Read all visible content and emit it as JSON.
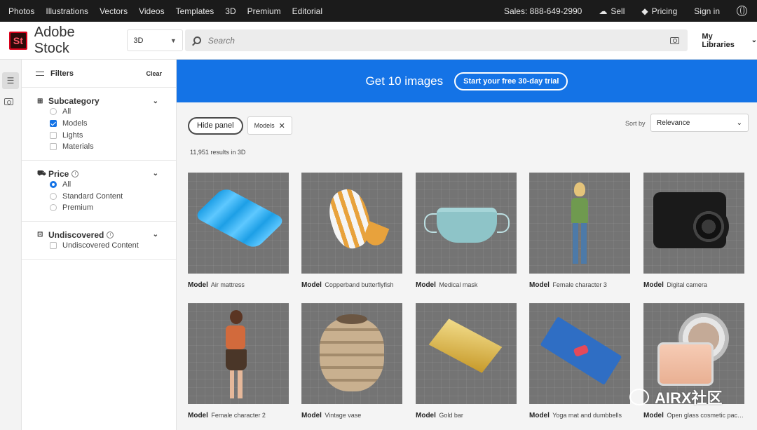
{
  "topnav": {
    "links": [
      "Photos",
      "Illustrations",
      "Vectors",
      "Videos",
      "Templates",
      "3D",
      "Premium",
      "Editorial"
    ],
    "sales": "Sales: 888-649-2990",
    "sell": "Sell",
    "pricing": "Pricing",
    "signin": "Sign in"
  },
  "header": {
    "logo_text": "St",
    "brand": "Adobe Stock",
    "category": "3D",
    "search_placeholder": "Search",
    "my_libraries": "My Libraries"
  },
  "filters": {
    "title": "Filters",
    "clear": "Clear",
    "subcategory": {
      "title": "Subcategory",
      "options": [
        {
          "label": "All",
          "checked": false
        },
        {
          "label": "Models",
          "checked": true
        },
        {
          "label": "Lights",
          "checked": false
        },
        {
          "label": "Materials",
          "checked": false
        }
      ]
    },
    "price": {
      "title": "Price",
      "options": [
        {
          "label": "All",
          "checked": true
        },
        {
          "label": "Standard Content",
          "checked": false
        },
        {
          "label": "Premium",
          "checked": false
        }
      ]
    },
    "undiscovered": {
      "title": "Undiscovered",
      "options": [
        {
          "label": "Undiscovered Content",
          "checked": false
        }
      ]
    }
  },
  "banner": {
    "text": "Get 10 images",
    "cta": "Start your free 30-day trial"
  },
  "toolbar": {
    "hide_panel": "Hide panel",
    "tag": "Models",
    "sort_label": "Sort by",
    "sort_value": "Relevance",
    "results": "11,951 results in 3D"
  },
  "items": [
    {
      "type": "Model",
      "title": "Air mattress",
      "art": "mattress"
    },
    {
      "type": "Model",
      "title": "Copperband butterflyfish",
      "art": "fish"
    },
    {
      "type": "Model",
      "title": "Medical mask",
      "art": "mask"
    },
    {
      "type": "Model",
      "title": "Female character 3",
      "art": "girl"
    },
    {
      "type": "Model",
      "title": "Digital camera",
      "art": "camera"
    },
    {
      "type": "Model",
      "title": "Female character 2",
      "art": "girl2"
    },
    {
      "type": "Model",
      "title": "Vintage vase",
      "art": "vase"
    },
    {
      "type": "Model",
      "title": "Gold bar",
      "art": "gold"
    },
    {
      "type": "Model",
      "title": "Yoga mat and dumbbells",
      "art": "yoga"
    },
    {
      "type": "Model",
      "title": "Open glass cosmetic packa...",
      "art": "jar"
    }
  ],
  "watermark": "AIRX社区",
  "colors": {
    "accent": "#1473e6",
    "topbar": "#1b1b1b",
    "brand_red": "#d9001b"
  }
}
